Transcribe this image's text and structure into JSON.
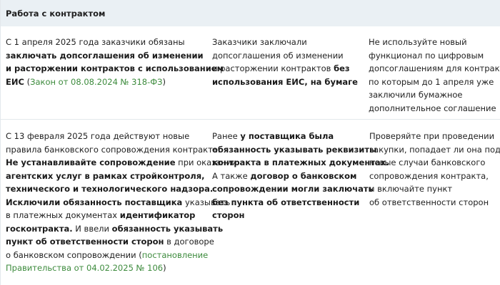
{
  "header": {
    "title": "Работа с контрактом"
  },
  "rows": [
    {
      "col1": [
        [
          {
            "t": "С 1 апреля 2025 года заказчики обязаны"
          }
        ],
        [
          {
            "t": "заключать допсоглашения об изменении",
            "b": true
          }
        ],
        [
          {
            "t": "и расторжении контрактов с использованием",
            "b": true
          }
        ],
        [
          {
            "t": "ЕИС",
            "b": true
          },
          {
            "t": " ("
          },
          {
            "t": "Закон от 08.08.2024 № 318-ФЗ",
            "link": true
          },
          {
            "t": ")"
          }
        ]
      ],
      "col2": [
        [
          {
            "t": "Заказчики заключали"
          }
        ],
        [
          {
            "t": "допсоглашения об изменении"
          }
        ],
        [
          {
            "t": "и расторжении контрактов "
          },
          {
            "t": "без",
            "b": true
          }
        ],
        [
          {
            "t": "использования ЕИС, на бумаге",
            "b": true
          }
        ]
      ],
      "col3": [
        [
          {
            "t": "Не используйте новый"
          }
        ],
        [
          {
            "t": "функционал по цифровым"
          }
        ],
        [
          {
            "t": "допсоглашениям для контрактов,"
          }
        ],
        [
          {
            "t": "по которым до 1 апреля уже"
          }
        ],
        [
          {
            "t": "заключили бумажное"
          }
        ],
        [
          {
            "t": "дополнительное соглашение"
          }
        ]
      ]
    },
    {
      "col1": [
        [
          {
            "t": "С 13 февраля 2025 года действуют новые"
          }
        ],
        [
          {
            "t": "правила банковского сопровождения контракта."
          }
        ],
        [
          {
            "t": "Не устанавливайте сопровождение",
            "b": true
          },
          {
            "t": " при оказании"
          }
        ],
        [
          {
            "t": "агентских услуг в рамках стройконтроля,",
            "b": true
          }
        ],
        [
          {
            "t": "технического и технологического надзора.",
            "b": true
          }
        ],
        [
          {
            "t": "Исключили обязанность поставщика",
            "b": true
          },
          {
            "t": " указывать"
          }
        ],
        [
          {
            "t": "в платежных документах "
          },
          {
            "t": "идентификатор",
            "b": true
          }
        ],
        [
          {
            "t": "госконтракта.",
            "b": true
          },
          {
            "t": " И ввели "
          },
          {
            "t": "обязанность указывать",
            "b": true
          }
        ],
        [
          {
            "t": "пункт об ответственности сторон",
            "b": true
          },
          {
            "t": " в договоре"
          }
        ],
        [
          {
            "t": "о банковском сопровождении ("
          },
          {
            "t": "постановление",
            "link": true
          }
        ],
        [
          {
            "t": "Правительства от 04.02.2025 № 106",
            "link": true
          },
          {
            "t": ")"
          }
        ]
      ],
      "col2": [
        [
          {
            "t": "Ранее "
          },
          {
            "t": "у поставщика была",
            "b": true
          }
        ],
        [
          {
            "t": "обязанность указывать реквизиты",
            "b": true
          }
        ],
        [
          {
            "t": "контракта в платежных документах.",
            "b": true
          }
        ],
        [
          {
            "t": "А также "
          },
          {
            "t": "договор о банковском",
            "b": true
          }
        ],
        [
          {
            "t": "сопровождении могли заключать",
            "b": true
          }
        ],
        [
          {
            "t": "без пункта об ответственности",
            "b": true
          }
        ],
        [
          {
            "t": "сторон",
            "b": true
          }
        ]
      ],
      "col3": [
        [
          {
            "t": "Проверяйте при проведении"
          }
        ],
        [
          {
            "t": "закупки, попадает ли она под"
          }
        ],
        [
          {
            "t": "новые случаи банковского"
          }
        ],
        [
          {
            "t": "сопровождения контракта,"
          }
        ],
        [
          {
            "t": "и включайте пункт"
          }
        ],
        [
          {
            "t": "об ответственности сторон"
          }
        ]
      ]
    }
  ]
}
